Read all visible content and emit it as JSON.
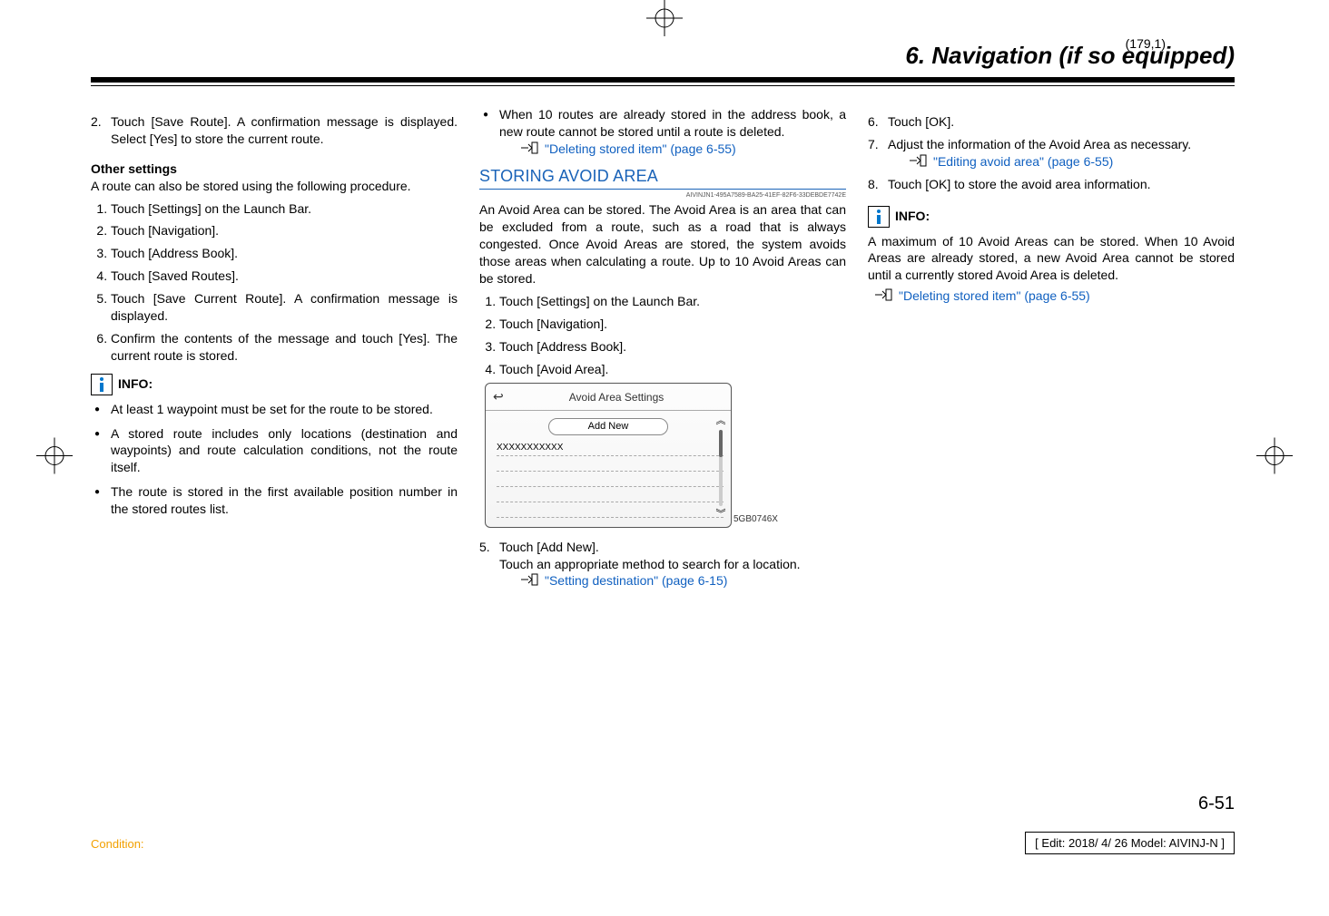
{
  "page_coord": "(179,1)",
  "section_title": "6. Navigation (if so equipped)",
  "col1": {
    "step2": "Touch [Save Route]. A confirmation message is displayed. Select [Yes] to store the current route.",
    "other_settings_h": "Other settings",
    "other_settings_p": "A route can also be stored using the following procedure.",
    "s1": "Touch [Settings] on the Launch Bar.",
    "s2": "Touch [Navigation].",
    "s3": "Touch [Address Book].",
    "s4": "Touch [Saved Routes].",
    "s5": "Touch [Save Current Route]. A confirmation message is displayed.",
    "s6": "Confirm the contents of the message and touch [Yes]. The current route is stored.",
    "info_label": "INFO:",
    "b1": "At least 1 waypoint must be set for the route to be stored.",
    "b2": "A stored route includes only locations (destination and waypoints) and route calculation conditions, not the route itself.",
    "b3": "The route is stored in the first available position number in the stored routes list."
  },
  "col2": {
    "b_top": "When 10 routes are already stored in the address book, a new route cannot be stored until a route is deleted.",
    "link_top": "\"Deleting stored item\" (page 6-55)",
    "heading": "STORING AVOID AREA",
    "guid": "AIVINJN1-495A7589-BA25-41EF-82F6-33DEBDE7742E",
    "para": "An Avoid Area can be stored. The Avoid Area is an area that can be excluded from a route, such as a road that is always congested. Once Avoid Areas are stored, the system avoids those areas when calculating a route. Up to 10 Avoid Areas can be stored.",
    "s1": "Touch [Settings] on the Launch Bar.",
    "s2": "Touch [Navigation].",
    "s3": "Touch [Address Book].",
    "s4": "Touch [Avoid Area].",
    "ss_title": "Avoid Area Settings",
    "ss_addnew": "Add New",
    "ss_item": "XXXXXXXXXXX",
    "img_code": "5GB0746X",
    "s5a": "Touch [Add New].",
    "s5b": "Touch an appropriate method to search for a location.",
    "link_bottom": "\"Setting destination\" (page 6-15)"
  },
  "col3": {
    "s6": "Touch [OK].",
    "s7": "Adjust the information of the Avoid Area as necessary.",
    "link7": "\"Editing avoid area\" (page 6-55)",
    "s8": "Touch [OK] to store the avoid area information.",
    "info_label": "INFO:",
    "info_p": "A maximum of 10 Avoid Areas can be stored. When 10 Avoid Areas are already stored, a new Avoid Area cannot be stored until a currently stored Avoid Area is deleted.",
    "link_end": "\"Deleting stored item\" (page 6-55)"
  },
  "page_num": "6-51",
  "condition": "Condition:",
  "edit_info": "[ Edit: 2018/ 4/ 26   Model:  AIVINJ-N ]"
}
